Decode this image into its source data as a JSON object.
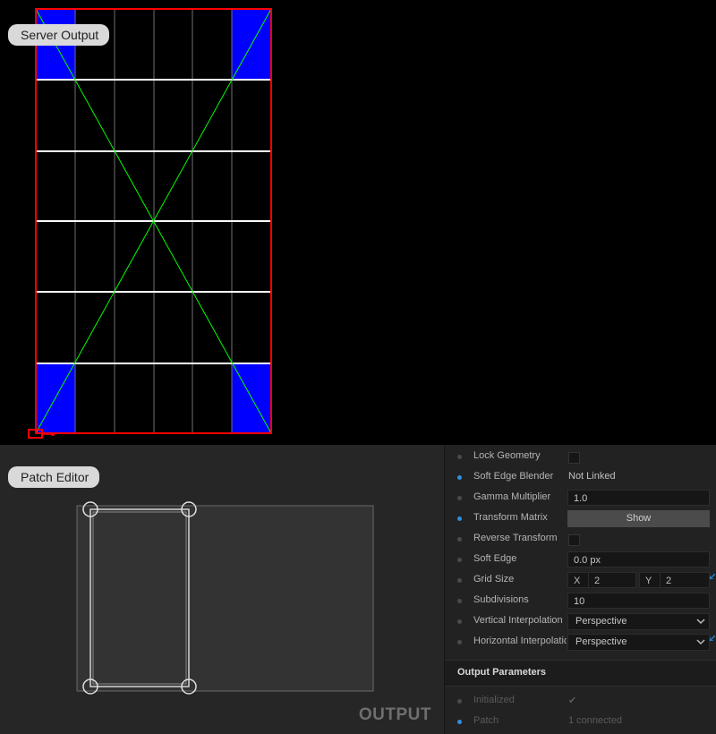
{
  "server_output": {
    "label": "Server Output",
    "colors": {
      "border": "#ff0000",
      "corner_fill": "#0000ff",
      "diagonal": "#00ff00",
      "grid": "#ffffff"
    }
  },
  "patch_editor": {
    "label": "Patch Editor",
    "output_label": "OUTPUT"
  },
  "properties": {
    "rows": [
      {
        "label": "Lock Geometry",
        "dot": "gray",
        "type": "checkbox",
        "value": ""
      },
      {
        "label": "Soft Edge Blender",
        "dot": "blue",
        "type": "text",
        "value": "Not Linked"
      },
      {
        "label": "Gamma Multiplier",
        "dot": "gray",
        "type": "field",
        "value": "1.0"
      },
      {
        "label": "Transform Matrix",
        "dot": "blue",
        "type": "button",
        "value": "Show"
      },
      {
        "label": "Reverse Transform",
        "dot": "gray",
        "type": "checkbox",
        "value": ""
      },
      {
        "label": "Soft Edge",
        "dot": "gray",
        "type": "field",
        "value": "0.0 px"
      },
      {
        "label": "Grid Size",
        "dot": "gray",
        "type": "xy",
        "x_label": "X",
        "x_value": "2",
        "y_label": "Y",
        "y_value": "2"
      },
      {
        "label": "Subdivisions",
        "dot": "gray",
        "type": "field",
        "value": "10"
      },
      {
        "label": "Vertical Interpolation",
        "dot": "gray",
        "type": "select",
        "value": "Perspective"
      },
      {
        "label": "Horizontal Interpolation",
        "dot": "gray",
        "type": "select",
        "value": "Perspective"
      }
    ],
    "section_title": "Output Parameters",
    "output_rows": [
      {
        "label": "Initialized",
        "dot": "gray",
        "value": "✔"
      },
      {
        "label": "Patch",
        "dot": "blue",
        "value": "1 connected"
      }
    ]
  }
}
